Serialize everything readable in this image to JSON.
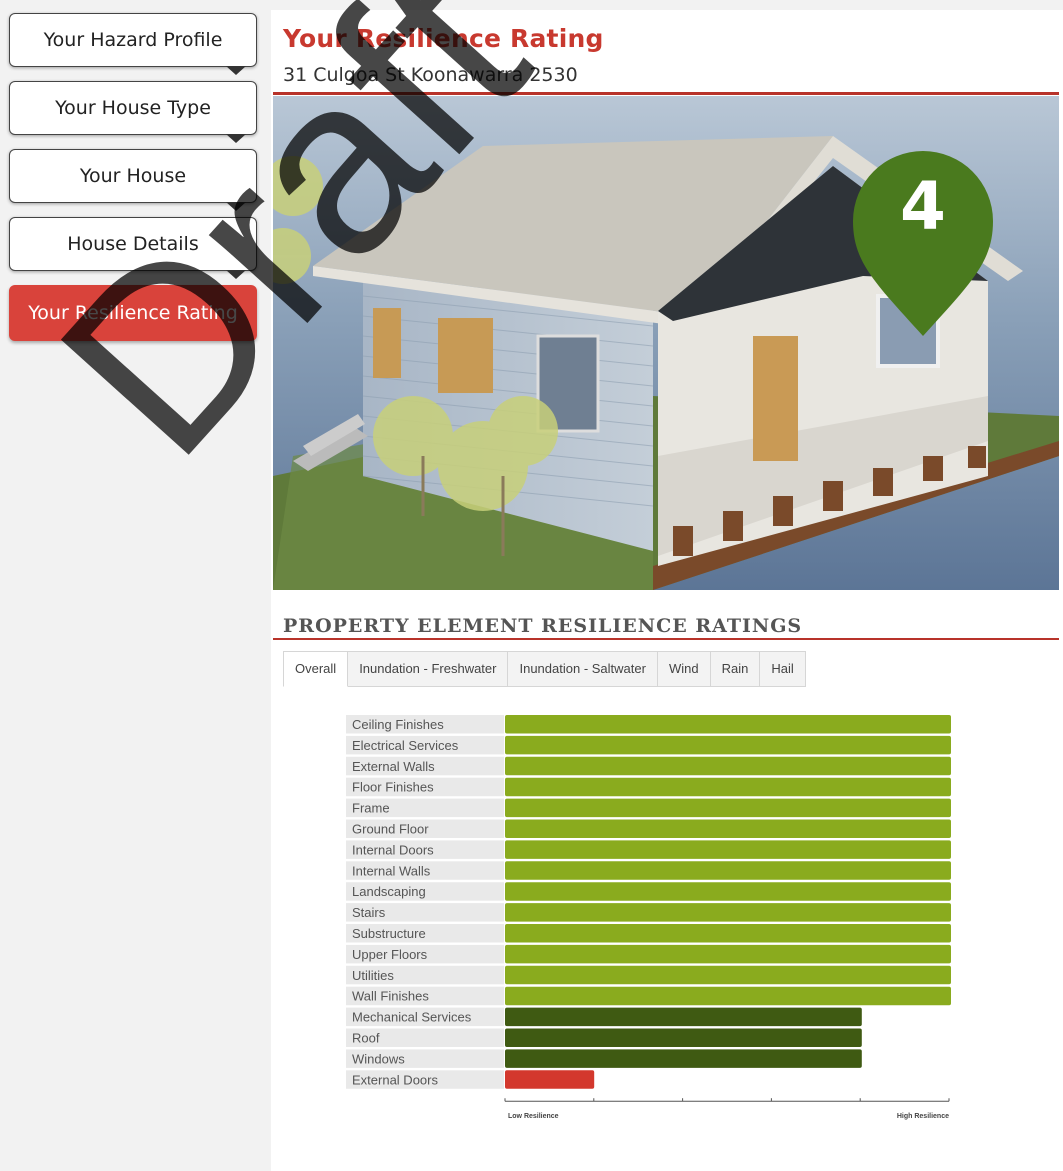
{
  "sidebar": {
    "items": [
      {
        "label": "Your Hazard Profile",
        "active": false
      },
      {
        "label": "Your House Type",
        "active": false
      },
      {
        "label": "Your House",
        "active": false
      },
      {
        "label": "House Details",
        "active": false
      },
      {
        "label": "Your Resilience Rating",
        "active": true
      }
    ]
  },
  "header": {
    "title": "Your Resilience Rating",
    "address": "31 Culgoa St Koonawarra 2530"
  },
  "rating": {
    "value": "4",
    "marker_color": "#4a7a1e"
  },
  "section": {
    "title": "PROPERTY ELEMENT RESILIENCE RATINGS"
  },
  "tabs": [
    {
      "label": "Overall",
      "active": true
    },
    {
      "label": "Inundation - Freshwater",
      "active": false
    },
    {
      "label": "Inundation - Saltwater",
      "active": false
    },
    {
      "label": "Wind",
      "active": false
    },
    {
      "label": "Rain",
      "active": false
    },
    {
      "label": "Hail",
      "active": false
    }
  ],
  "watermark": "Draft",
  "chart_data": {
    "type": "bar",
    "orientation": "horizontal",
    "categories": [
      "Ceiling Finishes",
      "Electrical Services",
      "External Walls",
      "Floor Finishes",
      "Frame",
      "Ground Floor",
      "Internal Doors",
      "Internal Walls",
      "Landscaping",
      "Stairs",
      "Substructure",
      "Upper Floors",
      "Utilities",
      "Wall Finishes",
      "Mechanical Services",
      "Roof",
      "Windows",
      "External Doors"
    ],
    "values": [
      5,
      5,
      5,
      5,
      5,
      5,
      5,
      5,
      5,
      5,
      5,
      5,
      5,
      5,
      4,
      4,
      4,
      1
    ],
    "colors": [
      "#8aab1e",
      "#8aab1e",
      "#8aab1e",
      "#8aab1e",
      "#8aab1e",
      "#8aab1e",
      "#8aab1e",
      "#8aab1e",
      "#8aab1e",
      "#8aab1e",
      "#8aab1e",
      "#8aab1e",
      "#8aab1e",
      "#8aab1e",
      "#3f5a12",
      "#3f5a12",
      "#3f5a12",
      "#d3382d"
    ],
    "xlim": [
      0,
      5
    ],
    "xlabel_low": "Low Resilience",
    "xlabel_high": "High Resilience"
  }
}
